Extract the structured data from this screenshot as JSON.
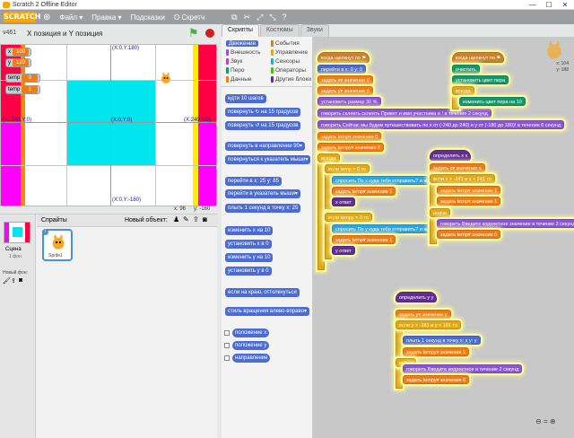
{
  "window": {
    "title": "Scratch 2 Offline Editor",
    "min": "—",
    "max": "☐",
    "close": "✕"
  },
  "menubar": {
    "logo": "SCRATCH",
    "file": "Файл ▾",
    "edit": "Правка ▾",
    "tips": "Подсказки",
    "about": "О Скретч"
  },
  "stage": {
    "version": "v461",
    "title": "X позиция и Y позиция",
    "labels": {
      "top": "(X:0,Y:180)",
      "bottom": "(X:0,Y:-180)",
      "left": "(X:-240,Y:0)",
      "right": "(X:240,Y:0)",
      "center": "(X:0,Y:0)"
    },
    "monitors": [
      {
        "name": "x",
        "value": "100"
      },
      {
        "name": "y",
        "value": "120"
      },
      {
        "name": "temp",
        "value": "0"
      },
      {
        "name": "temp",
        "value": "1"
      }
    ],
    "x_readout": "x: 96",
    "y_readout": "y: -160",
    "colors": {
      "cyan": "#00e5ee",
      "magenta": "#ff00ff",
      "red": "#ff0044",
      "orange": "#ff8800",
      "yellow": "#ffee00"
    }
  },
  "sprites": {
    "header": "Спрайты",
    "new_object": "Новый объект:",
    "stage_label": "Сцена",
    "stage_sub": "1 фон",
    "new_backdrop": "Новый фон:",
    "sprite_name": "Sprite1"
  },
  "tabs": {
    "scripts": "Скрипты",
    "costumes": "Костюмы",
    "sounds": "Звуки"
  },
  "categories": [
    {
      "label": "Движение",
      "color": "#4a6cd4"
    },
    {
      "label": "События",
      "color": "#c88330"
    },
    {
      "label": "Внешность",
      "color": "#8a55d7"
    },
    {
      "label": "Управление",
      "color": "#e1a91a"
    },
    {
      "label": "Звук",
      "color": "#bb42c3"
    },
    {
      "label": "Сенсоры",
      "color": "#2ca5e2"
    },
    {
      "label": "Перо",
      "color": "#0e9a6c"
    },
    {
      "label": "Операторы",
      "color": "#5cb712"
    },
    {
      "label": "Данные",
      "color": "#ee7d16"
    },
    {
      "label": "Другие блоки",
      "color": "#632d99"
    }
  ],
  "palette_blocks": [
    "идти 10 шагов",
    "повернуть ↻ на 15 градусов",
    "повернуть ↺ на 15 градусов",
    "повернуть в направлении 90▾",
    "повернуться к указатель мыши▾",
    "перейти в x: 25 y: 85",
    "перейти в указатель мыши▾",
    "плыть 1 секунд в точку x: 25",
    "изменить x на 10",
    "установить x в 0",
    "изменить y на 10",
    "установить y в 0",
    "если на краю, оттолкнуться",
    "стиль вращения влево-вправо▾",
    "положение x",
    "положение y",
    "направление"
  ],
  "scripts": {
    "a": [
      "когда щелкнут по ⚑",
      "перейти в x: 0 y: 0",
      "задать x▾ значение 0",
      "задать y▾ значение 0",
      "установить размер 30 %",
      "говорить склеить склеить Привет и имя участника и ! в течение 2 секунд",
      "говорить Сейчас мы будем путешествовать по x от (-240 до 240) и y от (-180 до 180)! в течение 6 секунд",
      "задать temp▾ значение 0",
      "задать tempy▾ значение 0",
      "всегда",
      "если temp = 0 то",
      "спросить По x куда тебя отправить? и ждать",
      "задать temp▾ значение 1",
      "x ответ",
      "если tempy = 0 то",
      "спросить По y куда тебя отправить? и ждать",
      "задать temp▾ значение 1",
      "y ответ"
    ],
    "b": [
      "когда щелкнут по ⚑",
      "очистить",
      "установить цвет пера",
      "всегда",
      "изменить цвет пера на 10"
    ],
    "c": [
      "определить x x",
      "задать x▾ значение x",
      "если x > -241 и x < 241 то",
      "задать temp▾ значение 1",
      "задать temp▾ значение 1",
      "иначе",
      "говорить Введите корректное значение в течение 2 секунд",
      "задать temp▾ значение 0"
    ],
    "d": [
      "определить y y",
      "задать y▾ значение y",
      "если y > -181 и y < 181 то",
      "плыть 1 секунд в точку x: x y: y",
      "задать tempy▾ значение 1",
      "иначе",
      "говорить Введите корректное в течение 2 секунд",
      "задать tempy▾ значение 0"
    ]
  },
  "sprite_info": {
    "name": "Sprite1",
    "x": "x: 104",
    "y": "y: 188"
  }
}
